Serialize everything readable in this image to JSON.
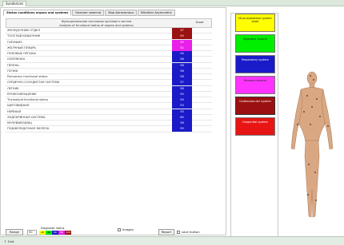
{
  "app": {
    "tab_label": "Sundarices"
  },
  "tabs": [
    {
      "label": "Status conditions organs and systems",
      "active": true
    },
    {
      "label": "Нижние заметки",
      "active": false
    },
    {
      "label": "Мир Автоматики",
      "active": false
    },
    {
      "label": "Mitrektor Asymmetric",
      "active": false
    }
  ],
  "grid": {
    "header_title": "Функциональное состояние органов и систем",
    "header_subtitle": "Analysis of functional status of organs and systems",
    "score_header": "Score",
    "rows": [
      {
        "name": "ЖЕЛУДОЧНИК ОТДЕЛ",
        "score": "47",
        "color": "#9b1111"
      },
      {
        "name": "ТОЛСТЫЙ КИШЕЧНИК",
        "score": "50",
        "color": "#9b1111"
      },
      {
        "name": "ГИПОФИЗ",
        "score": "45",
        "color": "#e81fe8"
      },
      {
        "name": "ЖЕЛЧНЫЙ ПУЗЫРЬ",
        "score": "52",
        "color": "#e81fe8"
      },
      {
        "name": "ПОЛОВЫЕ ОРГАНЫ",
        "score": "54",
        "color": "#1a1ac9"
      },
      {
        "name": "СЕЛЕЗЕНКА",
        "score": "56",
        "color": "#1a1ac9"
      },
      {
        "name": "ПЕЧЕНЬ",
        "score": "58",
        "color": "#1a1ac9"
      },
      {
        "name": "ПОЧКИ",
        "score": "56",
        "color": "#1a1ac9"
      },
      {
        "name": "Pulmonary functional status",
        "score": "58",
        "color": "#1a1ac9"
      },
      {
        "name": "СЕРДЕЧНО-СОСУДИСТАЯ СИСТЕМА",
        "score": "57",
        "color": "#1a1ac9"
      },
      {
        "name": "ЛЕГКИЕ",
        "score": "58",
        "color": "#1a1ac9"
      },
      {
        "name": "КРОВООБРАЩЕНИЕ",
        "score": "55",
        "color": "#1a1ac9"
      },
      {
        "name": "Thymolipid functional status",
        "score": "54",
        "color": "#1a1ac9"
      },
      {
        "name": "ЩИТОВИДНАЯ",
        "score": "53",
        "color": "#1a1ac9"
      },
      {
        "name": "НЕРВНАЯ",
        "score": "55",
        "color": "#1a1ac9"
      },
      {
        "name": "ЭНДОКРИННАЯ СИСТЕМА",
        "score": "60",
        "color": "#1a1ac9"
      },
      {
        "name": "МОЧЕВЫВОДЯЩ",
        "score": "58",
        "color": "#1a1ac9"
      },
      {
        "name": "ПОДЖЕЛУДОЧНАЯ ЖЕЛЕЗА",
        "score": "59",
        "color": "#1a1ac9"
      }
    ]
  },
  "bottom": {
    "range_button": "Range",
    "range_value": "50",
    "legend_title": "Diagnostic status",
    "legend": [
      {
        "label": "20",
        "color": "#ffff00"
      },
      {
        "label": "40",
        "color": "#00ee00"
      },
      {
        "label": "60",
        "color": "#1a1ac9"
      },
      {
        "label": "80",
        "color": "#e81fe8"
      },
      {
        "label": "100",
        "color": "#9b1111"
      }
    ],
    "images_label": "Images",
    "report_button": "Report",
    "save_button_label": "save button"
  },
  "systems": [
    {
      "label": "Musculoskeletal system state",
      "color": "#ffff00"
    },
    {
      "label": "Digestive system",
      "color": "#00ee00"
    },
    {
      "label": "Respiratory system",
      "color": "#1a1ac9"
    },
    {
      "label": "Nervous system",
      "color": "#ff33ff"
    },
    {
      "label": "Cardiovascular system",
      "color": "#9b1111"
    },
    {
      "label": "Urogenital system",
      "color": "#e81515"
    }
  ],
  "status": {
    "exit_label": "Exit"
  }
}
